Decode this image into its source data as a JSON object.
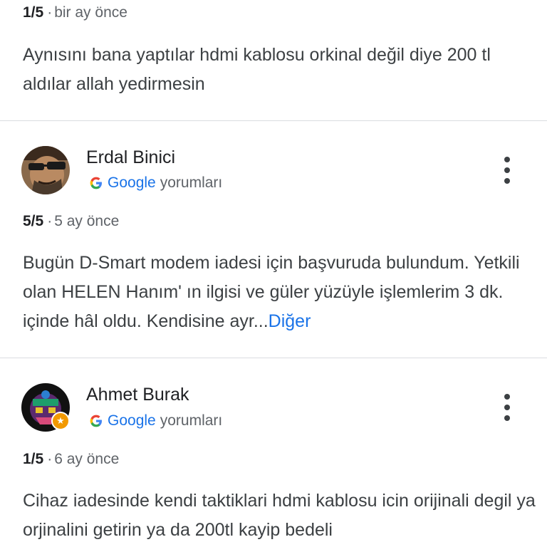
{
  "reviews": [
    {
      "rating": "1/5",
      "separator": "·",
      "time": "bir ay önce",
      "text": "Aynısını bana yaptılar hdmi kablosu orkinal değil diye 200 tl aldılar allah yedirmesin"
    },
    {
      "author": "Erdal Binici",
      "source_brand": "Google",
      "source_suffix": "yorumları",
      "rating": "5/5",
      "separator": "·",
      "time": "5 ay önce",
      "text": "Bugün D-Smart modem iadesi için başvuruda bulundum. Yetkili olan HELEN Hanım' ın ilgisi ve güler yüzüyle işlemlerim 3 dk. içinde hâl oldu. Kendisine ayr...",
      "more_label": "Diğer"
    },
    {
      "author": "Ahmet Burak",
      "source_brand": "Google",
      "source_suffix": "yorumları",
      "rating": "1/5",
      "separator": "·",
      "time": "6 ay önce",
      "text": "Cihaz iadesinde kendi taktiklari hdmi kablosu icin orijinali degil ya orjinalini getirin ya da 200tl kayip bedeli"
    }
  ],
  "colors": {
    "link": "#1a73e8",
    "divider": "#dadce0",
    "badge": "#f29900"
  },
  "icons": {
    "menu": "more-vert-icon",
    "source": "google-g-icon",
    "badge": "local-guide-star-icon"
  }
}
